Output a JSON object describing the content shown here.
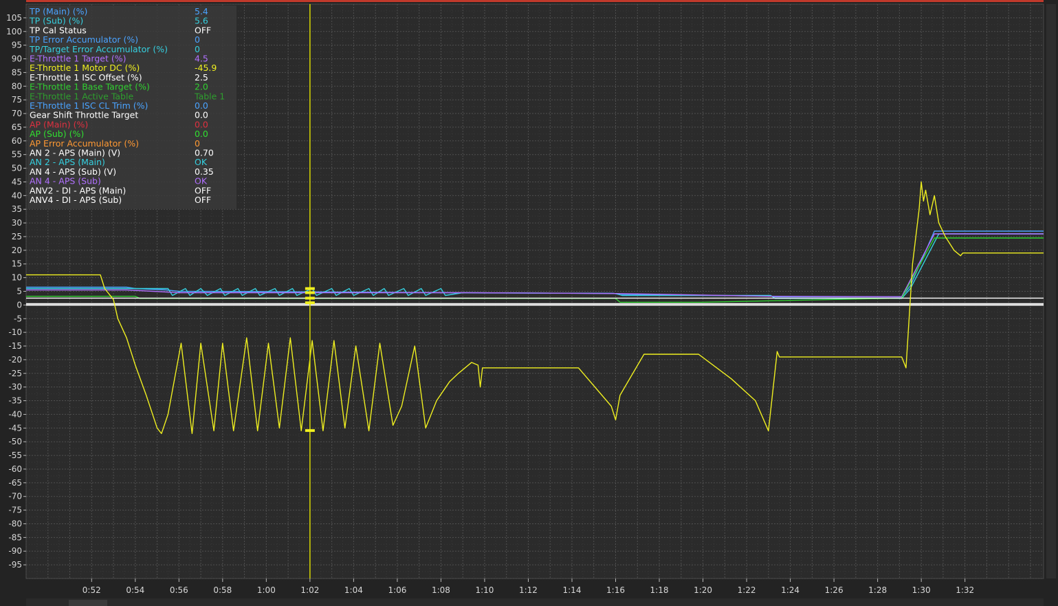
{
  "colors": {
    "background": "#232323",
    "plot_background": "#2b2b2b",
    "grid": "#505050",
    "legend_panel": "#3a3a3a",
    "cursor": "#d8d800",
    "top_bar": "#c0392b"
  },
  "cursor": {
    "x": "1:02"
  },
  "chart_data": {
    "type": "line",
    "title": "",
    "xlabel": "",
    "ylabel": "",
    "grid": true,
    "legend_placement": "top-left",
    "xlim": [
      "0:49",
      "1:35.6"
    ],
    "ylim": [
      -100,
      110
    ],
    "x_ticks": [
      "0:52",
      "0:54",
      "0:56",
      "0:58",
      "1:00",
      "1:02",
      "1:04",
      "1:06",
      "1:08",
      "1:10",
      "1:12",
      "1:14",
      "1:16",
      "1:18",
      "1:20",
      "1:22",
      "1:24",
      "1:26",
      "1:28",
      "1:30",
      "1:32"
    ],
    "y_ticks": [
      105,
      100,
      95,
      90,
      85,
      80,
      75,
      70,
      65,
      60,
      55,
      50,
      45,
      40,
      35,
      30,
      25,
      20,
      15,
      10,
      5,
      0,
      -5,
      -10,
      -15,
      -20,
      -25,
      -30,
      -35,
      -40,
      -45,
      -50,
      -55,
      -60,
      -65,
      -70,
      -75,
      -80,
      -85,
      -90,
      -95
    ],
    "legend": [
      {
        "label": "TP (Main) (%)",
        "value": "5.4",
        "color": "#4aa3ff"
      },
      {
        "label": "TP (Sub) (%)",
        "value": "5.6",
        "color": "#35d0e0"
      },
      {
        "label": "TP Cal Status",
        "value": "OFF",
        "color": "#ffffff"
      },
      {
        "label": "TP Error Accumulator (%)",
        "value": "0",
        "color": "#4aa3ff"
      },
      {
        "label": "TP/Target Error Accumulator (%)",
        "value": "0",
        "color": "#35d0e0"
      },
      {
        "label": "E-Throttle 1 Target (%)",
        "value": "4.5",
        "color": "#b070ff"
      },
      {
        "label": "E-Throttle 1 Motor DC (%)",
        "value": "-45.9",
        "color": "#f0f020"
      },
      {
        "label": "E-Throttle 1 ISC Offset (%)",
        "value": "2.5",
        "color": "#ffffff"
      },
      {
        "label": "E-Throttle 1 Base Target (%)",
        "value": "2.0",
        "color": "#30d030"
      },
      {
        "label": "E-Throttle 1 Active Table",
        "value": "Table 1",
        "color": "#2e9e2e"
      },
      {
        "label": "E-Throttle 1 ISC CL Trim (%)",
        "value": "0.0",
        "color": "#4aa3ff"
      },
      {
        "label": "Gear Shift Throttle Target",
        "value": "0.0",
        "color": "#ffffff"
      },
      {
        "label": "AP (Main) (%)",
        "value": "0.0",
        "color": "#e03040"
      },
      {
        "label": "AP (Sub) (%)",
        "value": "0.0",
        "color": "#30e030"
      },
      {
        "label": "AP Error Accumulator (%)",
        "value": "0",
        "color": "#ff9933"
      },
      {
        "label": "AN 2 - APS (Main) (V)",
        "value": "0.70",
        "color": "#ffffff"
      },
      {
        "label": "AN 2 - APS (Main)",
        "value": "OK",
        "color": "#35d0e0"
      },
      {
        "label": "AN 4 - APS (Sub) (V)",
        "value": "0.35",
        "color": "#ffffff"
      },
      {
        "label": "AN 4 - APS (Sub)",
        "value": "OK",
        "color": "#b070ff"
      },
      {
        "label": "ANV2 - DI  - APS (Main)",
        "value": "OFF",
        "color": "#ffffff"
      },
      {
        "label": "ANV4 - DI  - APS (Sub)",
        "value": "OFF",
        "color": "#ffffff"
      }
    ],
    "series": [
      {
        "legend_ref": "TP (Main) (%)",
        "color": "#4aa3ff",
        "x": [
          "0:49",
          "0:53.6",
          "0:54",
          "0:55.4",
          "0:56",
          "1:00",
          "1:04",
          "1:08",
          "1:10",
          "1:15.9",
          "1:16.2",
          "1:23.1",
          "1:23.3",
          "1:29.1",
          "1:29.5",
          "1:30.6",
          "1:35.6"
        ],
        "y": [
          6.5,
          6.5,
          6,
          5.5,
          5,
          4.9,
          4.7,
          4.5,
          4.4,
          4.3,
          3.8,
          3.3,
          3.0,
          3.0,
          7,
          27,
          27
        ]
      },
      {
        "legend_ref": "TP (Sub) (%)",
        "color": "#35d0e0",
        "x": [
          "0:49",
          "0:55.5",
          "0:55.7",
          "0:56.3",
          "0:56.5",
          "0:57",
          "0:57.3",
          "0:57.9",
          "0:58.1",
          "0:58.7",
          "0:58.9",
          "0:59.5",
          "0:59.7",
          "1:00.4",
          "1:00.6",
          "1:01.2",
          "1:01.4",
          "1:02.1",
          "1:02.3",
          "1:03",
          "1:03.2",
          "1:03.8",
          "1:04",
          "1:04.7",
          "1:04.9",
          "1:05.4",
          "1:05.6",
          "1:06.3",
          "1:06.5",
          "1:07.1",
          "1:07.3",
          "1:08",
          "1:08.2",
          "1:09",
          "1:16",
          "1:16.3",
          "1:23.1",
          "1:23.3",
          "1:29.1",
          "1:29.5",
          "1:30.8",
          "1:35.6"
        ],
        "y": [
          6,
          6,
          3.5,
          6,
          3.5,
          6,
          3.5,
          6,
          3.5,
          6,
          3.5,
          6,
          3.5,
          6,
          3.5,
          6,
          3.5,
          6,
          3.5,
          6,
          3.5,
          6,
          3.5,
          6,
          3.5,
          6,
          3.5,
          6,
          3.5,
          6,
          3.5,
          6,
          3.5,
          4.5,
          4.2,
          3.5,
          3.5,
          2.4,
          2.4,
          6,
          26,
          26
        ]
      },
      {
        "legend_ref": "E-Throttle 1 Target (%)",
        "color": "#b070ff",
        "x": [
          "0:49",
          "0:53.6",
          "0:56",
          "1:09",
          "1:16",
          "1:23",
          "1:29.1",
          "1:30.6",
          "1:35.6"
        ],
        "y": [
          5.5,
          5.5,
          4.5,
          4.5,
          4.2,
          3.2,
          3.0,
          26,
          26
        ]
      },
      {
        "legend_ref": "E-Throttle 1 Base Target (%)",
        "color": "#30d030",
        "x": [
          "0:49",
          "0:54",
          "0:54.2",
          "1:16",
          "1:16.2",
          "1:19.9",
          "1:29.1",
          "1:30.6",
          "1:35.6"
        ],
        "y": [
          3.2,
          3.2,
          2.4,
          2.4,
          1.0,
          1.0,
          2.5,
          24.5,
          24.5
        ]
      },
      {
        "legend_ref": "E-Throttle 1 ISC Offset (%)",
        "color": "#ffffff",
        "x": [
          "0:49",
          "1:35.6"
        ],
        "y": [
          2.5,
          2.5
        ]
      },
      {
        "legend_ref": "Gear Shift Throttle Target",
        "color": "#ffffff",
        "x": [
          "0:49",
          "1:35.6"
        ],
        "y": [
          0.5,
          0.5
        ]
      },
      {
        "legend_ref": "E-Throttle 1 Motor DC (%)",
        "color": "#f0f020",
        "x": [
          "0:49",
          "0:52.4",
          "0:52.6",
          "0:53",
          "0:53.2",
          "0:53.6",
          "0:54",
          "0:54.5",
          "0:55",
          "0:55.2",
          "0:55.5",
          "0:56.1",
          "0:56.6",
          "0:57",
          "0:57.6",
          "0:58",
          "0:58.5",
          "0:59.1",
          "0:59.6",
          "1:00.1",
          "1:00.6",
          "1:01.1",
          "1:01.6",
          "1:02.1",
          "1:02.6",
          "1:03.1",
          "1:03.6",
          "1:04.1",
          "1:04.7",
          "1:05.2",
          "1:05.8",
          "1:06.2",
          "1:06.8",
          "1:07.3",
          "1:07.8",
          "1:08.4",
          "1:08.8",
          "1:09.4",
          "1:09.7",
          "1:09.8",
          "1:09.9",
          "1:14.3",
          "1:15.8",
          "1:16",
          "1:16.2",
          "1:17.3",
          "1:17.6",
          "1:19.8",
          "1:21.3",
          "1:22.4",
          "1:23",
          "1:23.4",
          "1:23.5",
          "1:29.1",
          "1:29.3",
          "1:29.6",
          "1:29.9",
          "1:30",
          "1:30.1",
          "1:30.2",
          "1:30.4",
          "1:30.6",
          "1:30.8",
          "1:31.1",
          "1:31.5",
          "1:31.8",
          "1:31.9",
          "1:35.6"
        ],
        "y": [
          11,
          11,
          6,
          2,
          -5,
          -12,
          -22,
          -33,
          -45,
          -47,
          -40,
          -14,
          -47,
          -14,
          -46,
          -14,
          -46,
          -12,
          -46,
          -14,
          -45,
          -12,
          -46,
          -13,
          -46,
          -13,
          -45,
          -15,
          -46,
          -14,
          -44,
          -37,
          -15,
          -45,
          -35,
          -28,
          -25,
          -21,
          -22,
          -30,
          -23,
          -23,
          -37,
          -42,
          -33,
          -18,
          -18,
          -18,
          -27,
          -35,
          -46,
          -17,
          -19,
          -19,
          -23,
          15,
          35,
          45,
          38,
          42,
          33,
          40,
          30,
          25,
          20,
          18,
          19,
          19
        ]
      }
    ]
  }
}
